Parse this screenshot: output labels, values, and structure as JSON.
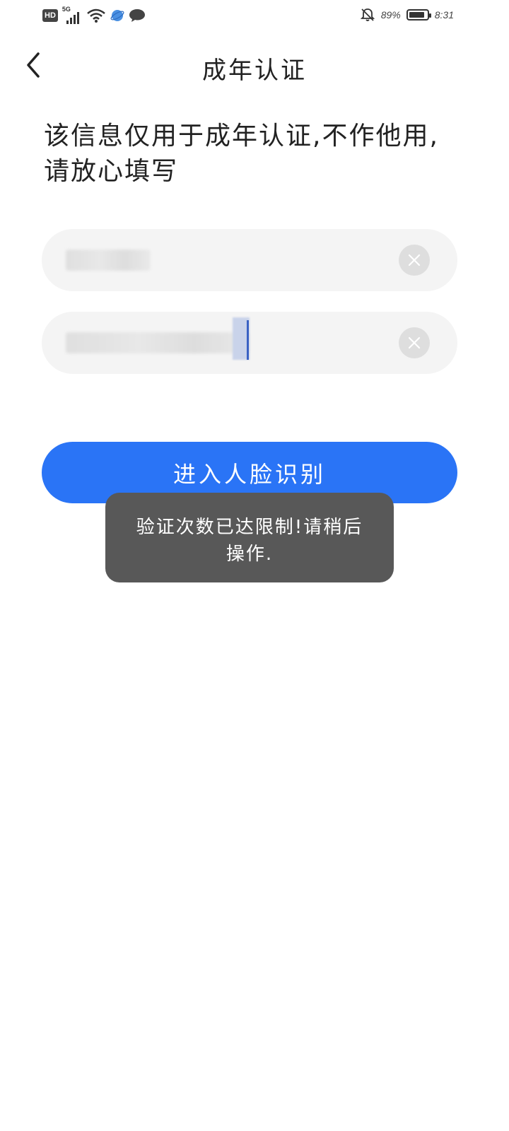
{
  "status_bar": {
    "hd_label": "HD",
    "network_label": "5G",
    "battery_percent": "89%",
    "battery_level": 0.89,
    "time": "8:31",
    "icons": [
      "hd-icon",
      "signal-icon",
      "wifi-icon",
      "browser-icon",
      "chat-icon",
      "mute-bell-icon",
      "battery-icon"
    ]
  },
  "header": {
    "title": "成年认证",
    "back_icon": "chevron-left-icon"
  },
  "intro": {
    "text": "该信息仅用于成年认证,不作他用,请放心填写"
  },
  "form": {
    "name_field": {
      "value_hidden": true,
      "clear_icon": "clear-icon"
    },
    "id_field": {
      "value_hidden": true,
      "clear_icon": "clear-icon"
    }
  },
  "actions": {
    "face_recognition_label": "进入人脸识别"
  },
  "toast": {
    "message": "验证次数已达限制!请稍后操作."
  },
  "colors": {
    "accent": "#2a74f6",
    "toast_bg": "#585858",
    "field_bg": "#f4f4f4"
  }
}
